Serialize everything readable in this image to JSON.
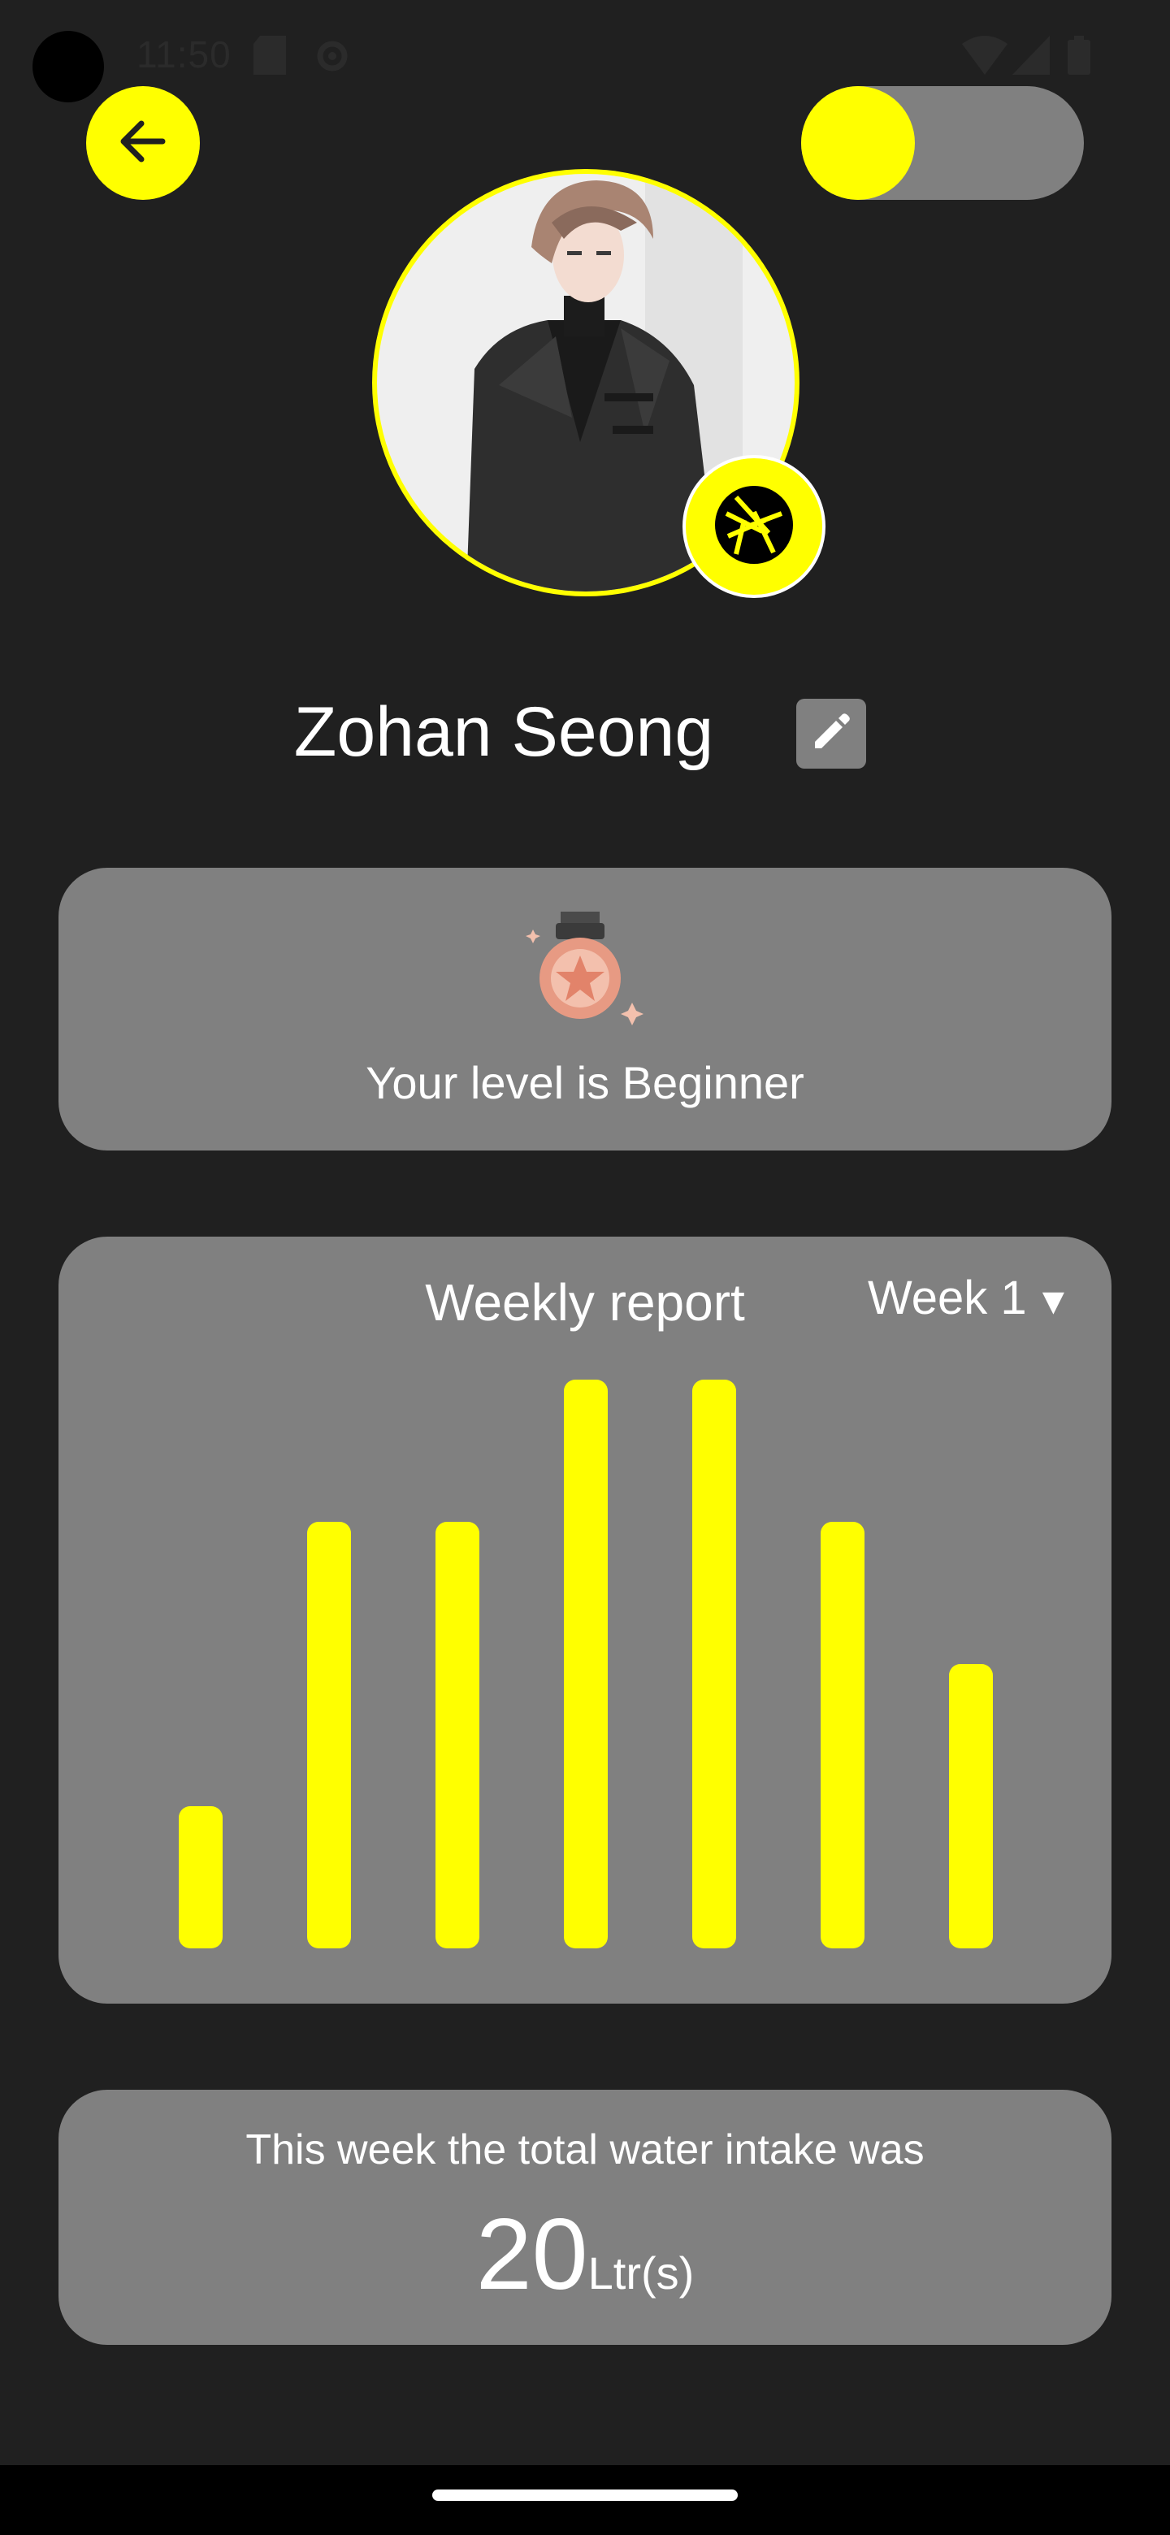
{
  "status_bar": {
    "time": "11:50",
    "icons": [
      "sd-card-icon",
      "settings-icon",
      "wifi-icon",
      "signal-icon",
      "battery-icon"
    ]
  },
  "header": {
    "back_icon": "arrow-left-icon",
    "toggle_state": "on"
  },
  "profile": {
    "name": "Zohan Seong",
    "avatar_icon": "profile-photo",
    "camera_icon": "camera-aperture-icon",
    "edit_icon": "pencil-icon"
  },
  "level": {
    "icon": "bronze-medal-icon",
    "text": "Your level is Beginner"
  },
  "report": {
    "title": "Weekly report",
    "week_label": "Week 1",
    "dropdown_arrow": "▼"
  },
  "chart_data": {
    "type": "bar",
    "values": [
      2,
      6,
      6,
      8,
      8,
      6,
      4
    ],
    "ylim": [
      0,
      8
    ],
    "bar_color": "#ffff00"
  },
  "intake": {
    "text": "This week the total water intake was",
    "value": "20",
    "unit": "Ltr(s)"
  },
  "colors": {
    "accent": "#ffff00",
    "card": "#808080",
    "background": "#202020"
  }
}
